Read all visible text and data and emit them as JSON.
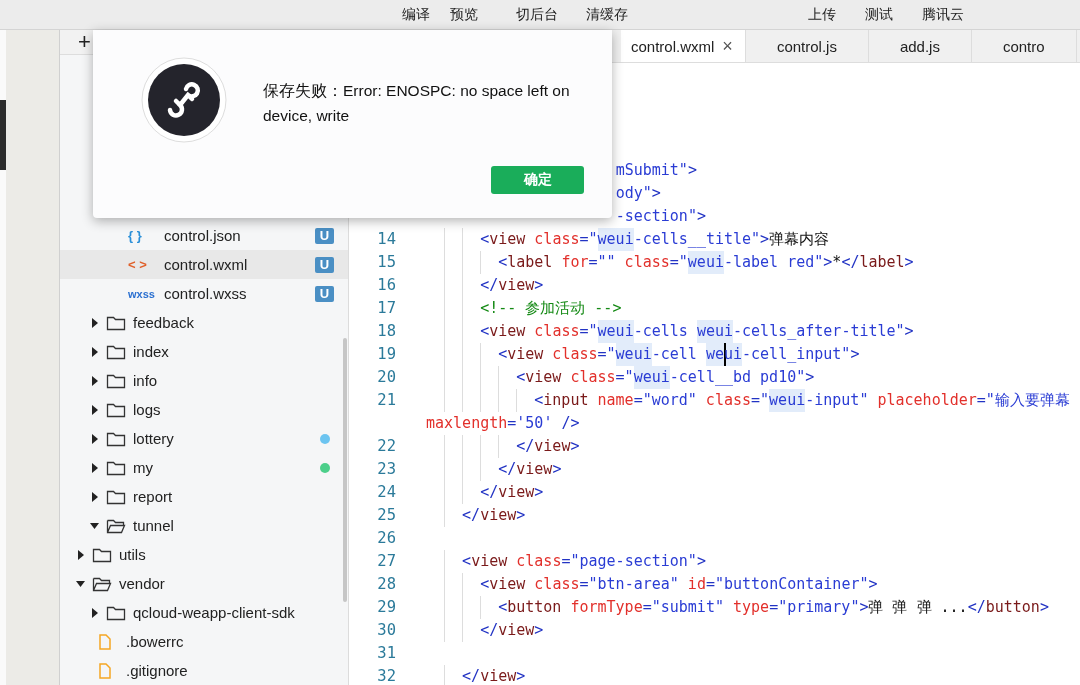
{
  "menu_bar": {
    "left": [
      "编译",
      "预览",
      "切后台",
      "清缓存"
    ],
    "right": [
      "上传",
      "测试",
      "腾讯云"
    ]
  },
  "toolbar": {
    "add_button": "+"
  },
  "tabs": [
    {
      "label": "control.wxml",
      "selected": true,
      "close": "×"
    },
    {
      "label": "control.js",
      "selected": false
    },
    {
      "label": "add.js",
      "selected": false
    },
    {
      "label": "contro",
      "selected": false
    }
  ],
  "sidebar": {
    "tree": [
      {
        "kind": "covered",
        "children": [
          {
            "kind": "covered",
            "children": [
              {
                "kind": "json-file",
                "type_label": "{ }",
                "label": "control.json",
                "badge": "U",
                "selected": false
              },
              {
                "kind": "wxml-file",
                "type_label": "< >",
                "label": "control.wxml",
                "badge": "U",
                "selected": true
              },
              {
                "kind": "wxss-file",
                "type_label": "wxss",
                "label": "control.wxss",
                "badge": "U",
                "selected": false
              }
            ]
          },
          {
            "kind": "folder",
            "label": "feedback",
            "expanded": false
          },
          {
            "kind": "folder",
            "label": "index",
            "expanded": false
          },
          {
            "kind": "folder",
            "label": "info",
            "expanded": false
          },
          {
            "kind": "folder",
            "label": "logs",
            "expanded": false
          },
          {
            "kind": "folder",
            "label": "lottery",
            "expanded": false,
            "color": "#6cc4f0"
          },
          {
            "kind": "folder",
            "label": "my",
            "expanded": false,
            "color": "#4ccf8a"
          },
          {
            "kind": "folder",
            "label": "report",
            "expanded": false
          },
          {
            "kind": "folder",
            "label": "tunnel",
            "expanded": true
          }
        ]
      },
      {
        "kind": "folder",
        "label": "utils",
        "expanded": false
      },
      {
        "kind": "folder",
        "label": "vendor",
        "expanded": true,
        "children": [
          {
            "kind": "folder",
            "label": "qcloud-weapp-client-sdk",
            "expanded": false
          },
          {
            "kind": "plain-file",
            "label": ".bowerrc",
            "selected": false
          },
          {
            "kind": "plain-file",
            "label": ".gitignore",
            "selected": false
          }
        ]
      }
    ]
  },
  "editor": {
    "lines": [
      {
        "kind": "partial",
        "tokens": [
          {
            "kind": "string",
            "text": "mSubmit\""
          },
          {
            "kind": "punct",
            "text": ">"
          }
        ]
      },
      {
        "kind": "partial",
        "tokens": [
          {
            "kind": "string",
            "text": "ody\""
          },
          {
            "kind": "punct",
            "text": ">"
          }
        ]
      },
      {
        "kind": "partial",
        "tokens": [
          {
            "kind": "string",
            "text": "-section\""
          },
          {
            "kind": "punct",
            "text": ">"
          }
        ]
      },
      {
        "kind": "code",
        "number": "14",
        "tokens": [
          {
            "kind": "punct",
            "text": "      <"
          },
          {
            "kind": "tag",
            "text": "view"
          },
          {
            "kind": "attr",
            "text": " class"
          },
          {
            "kind": "punct",
            "text": "="
          },
          {
            "kind": "string",
            "text": "\""
          },
          {
            "kind": "match",
            "text": "weui"
          },
          {
            "kind": "string",
            "text": "-cells__title\""
          },
          {
            "kind": "punct",
            "text": ">"
          },
          {
            "kind": "text",
            "text": "弹幕内容"
          }
        ]
      },
      {
        "kind": "code",
        "number": "15",
        "tokens": [
          {
            "kind": "punct",
            "text": "        <"
          },
          {
            "kind": "tag",
            "text": "label"
          },
          {
            "kind": "attr",
            "text": " for"
          },
          {
            "kind": "punct",
            "text": "="
          },
          {
            "kind": "string",
            "text": "\"\""
          },
          {
            "kind": "attr",
            "text": " class"
          },
          {
            "kind": "punct",
            "text": "="
          },
          {
            "kind": "string",
            "text": "\""
          },
          {
            "kind": "match",
            "text": "weui"
          },
          {
            "kind": "string",
            "text": "-label red\""
          },
          {
            "kind": "punct",
            "text": ">"
          },
          {
            "kind": "text",
            "text": "*"
          },
          {
            "kind": "punct",
            "text": "</"
          },
          {
            "kind": "tag",
            "text": "label"
          },
          {
            "kind": "punct",
            "text": ">"
          }
        ]
      },
      {
        "kind": "code",
        "number": "16",
        "tokens": [
          {
            "kind": "punct",
            "text": "      </"
          },
          {
            "kind": "tag",
            "text": "view"
          },
          {
            "kind": "punct",
            "text": ">"
          }
        ]
      },
      {
        "kind": "code",
        "number": "17",
        "tokens": [
          {
            "kind": "comment",
            "text": "      <!-- 参加活动 -->"
          }
        ]
      },
      {
        "kind": "code",
        "number": "18",
        "tokens": [
          {
            "kind": "punct",
            "text": "      <"
          },
          {
            "kind": "tag",
            "text": "view"
          },
          {
            "kind": "attr",
            "text": " class"
          },
          {
            "kind": "punct",
            "text": "="
          },
          {
            "kind": "string",
            "text": "\""
          },
          {
            "kind": "match",
            "text": "weui"
          },
          {
            "kind": "string",
            "text": "-cells "
          },
          {
            "kind": "match",
            "text": "weui"
          },
          {
            "kind": "string",
            "text": "-cells_after-title\""
          },
          {
            "kind": "punct",
            "text": ">"
          }
        ]
      },
      {
        "kind": "code",
        "number": "19",
        "tokens": [
          {
            "kind": "punct",
            "text": "        <"
          },
          {
            "kind": "tag",
            "text": "view"
          },
          {
            "kind": "attr",
            "text": " class"
          },
          {
            "kind": "punct",
            "text": "="
          },
          {
            "kind": "string",
            "text": "\""
          },
          {
            "kind": "match",
            "text": "weui"
          },
          {
            "kind": "string",
            "text": "-cell "
          },
          {
            "kind": "match",
            "text": "we"
          },
          {
            "kind": "caret"
          },
          {
            "kind": "match",
            "text": "ui"
          },
          {
            "kind": "string",
            "text": "-cell_input\""
          },
          {
            "kind": "punct",
            "text": ">"
          }
        ]
      },
      {
        "kind": "code",
        "number": "20",
        "tokens": [
          {
            "kind": "punct",
            "text": "          <"
          },
          {
            "kind": "tag",
            "text": "view"
          },
          {
            "kind": "attr",
            "text": " class"
          },
          {
            "kind": "punct",
            "text": "="
          },
          {
            "kind": "string",
            "text": "\""
          },
          {
            "kind": "match",
            "text": "weui"
          },
          {
            "kind": "string",
            "text": "-cell__bd pd10\""
          },
          {
            "kind": "punct",
            "text": ">"
          }
        ]
      },
      {
        "kind": "code",
        "number": "21",
        "tokens": [
          {
            "kind": "punct",
            "text": "            <"
          },
          {
            "kind": "tag",
            "text": "input"
          },
          {
            "kind": "attr",
            "text": " name"
          },
          {
            "kind": "punct",
            "text": "="
          },
          {
            "kind": "string",
            "text": "\"word\""
          },
          {
            "kind": "attr",
            "text": " class"
          },
          {
            "kind": "punct",
            "text": "="
          },
          {
            "kind": "string",
            "text": "\""
          },
          {
            "kind": "match",
            "text": "weui"
          },
          {
            "kind": "string",
            "text": "-input\""
          },
          {
            "kind": "attr",
            "text": " placeholder"
          },
          {
            "kind": "punct",
            "text": "="
          },
          {
            "kind": "string",
            "text": "\"输入要弹幕"
          }
        ],
        "wrap": [
          {
            "kind": "attr",
            "text": "maxlength"
          },
          {
            "kind": "punct",
            "text": "="
          },
          {
            "kind": "string",
            "text": "'50'"
          },
          {
            "kind": "punct",
            "text": " />"
          }
        ]
      },
      {
        "kind": "code",
        "number": "22",
        "tokens": [
          {
            "kind": "punct",
            "text": "          </"
          },
          {
            "kind": "tag",
            "text": "view"
          },
          {
            "kind": "punct",
            "text": ">"
          }
        ]
      },
      {
        "kind": "code",
        "number": "23",
        "tokens": [
          {
            "kind": "punct",
            "text": "        </"
          },
          {
            "kind": "tag",
            "text": "view"
          },
          {
            "kind": "punct",
            "text": ">"
          }
        ]
      },
      {
        "kind": "code",
        "number": "24",
        "tokens": [
          {
            "kind": "punct",
            "text": "      </"
          },
          {
            "kind": "tag",
            "text": "view"
          },
          {
            "kind": "punct",
            "text": ">"
          }
        ]
      },
      {
        "kind": "code",
        "number": "25",
        "tokens": [
          {
            "kind": "punct",
            "text": "    </"
          },
          {
            "kind": "tag",
            "text": "view"
          },
          {
            "kind": "punct",
            "text": ">"
          }
        ]
      },
      {
        "kind": "code",
        "number": "26"
      },
      {
        "kind": "code",
        "number": "27",
        "tokens": [
          {
            "kind": "punct",
            "text": "    <"
          },
          {
            "kind": "tag",
            "text": "view"
          },
          {
            "kind": "attr",
            "text": " class"
          },
          {
            "kind": "punct",
            "text": "="
          },
          {
            "kind": "string",
            "text": "\"page-section\""
          },
          {
            "kind": "punct",
            "text": ">"
          }
        ]
      },
      {
        "kind": "code",
        "number": "28",
        "tokens": [
          {
            "kind": "punct",
            "text": "      <"
          },
          {
            "kind": "tag",
            "text": "view"
          },
          {
            "kind": "attr",
            "text": " class"
          },
          {
            "kind": "punct",
            "text": "="
          },
          {
            "kind": "string",
            "text": "\"btn-area\""
          },
          {
            "kind": "attr",
            "text": " id"
          },
          {
            "kind": "punct",
            "text": "="
          },
          {
            "kind": "string",
            "text": "\"buttonContainer\""
          },
          {
            "kind": "punct",
            "text": ">"
          }
        ]
      },
      {
        "kind": "code",
        "number": "29",
        "tokens": [
          {
            "kind": "punct",
            "text": "        <"
          },
          {
            "kind": "tag",
            "text": "button"
          },
          {
            "kind": "attr",
            "text": " formType"
          },
          {
            "kind": "punct",
            "text": "="
          },
          {
            "kind": "string",
            "text": "\"submit\""
          },
          {
            "kind": "attr",
            "text": " type"
          },
          {
            "kind": "punct",
            "text": "="
          },
          {
            "kind": "string",
            "text": "\"primary\""
          },
          {
            "kind": "punct",
            "text": ">"
          },
          {
            "kind": "text",
            "text": "弹 弹 弹 ..."
          },
          {
            "kind": "punct",
            "text": "</"
          },
          {
            "kind": "tag",
            "text": "button"
          },
          {
            "kind": "punct",
            "text": ">"
          }
        ]
      },
      {
        "kind": "code",
        "number": "30",
        "tokens": [
          {
            "kind": "punct",
            "text": "      </"
          },
          {
            "kind": "tag",
            "text": "view"
          },
          {
            "kind": "punct",
            "text": ">"
          }
        ]
      },
      {
        "kind": "code",
        "number": "31"
      },
      {
        "kind": "code",
        "number": "32",
        "tokens": [
          {
            "kind": "punct",
            "text": "    </"
          },
          {
            "kind": "tag",
            "text": "view"
          },
          {
            "kind": "punct",
            "text": ">"
          }
        ]
      }
    ]
  },
  "dialog": {
    "message": "保存失败：Error: ENOSPC: no space left on device, write",
    "button": "确定"
  }
}
